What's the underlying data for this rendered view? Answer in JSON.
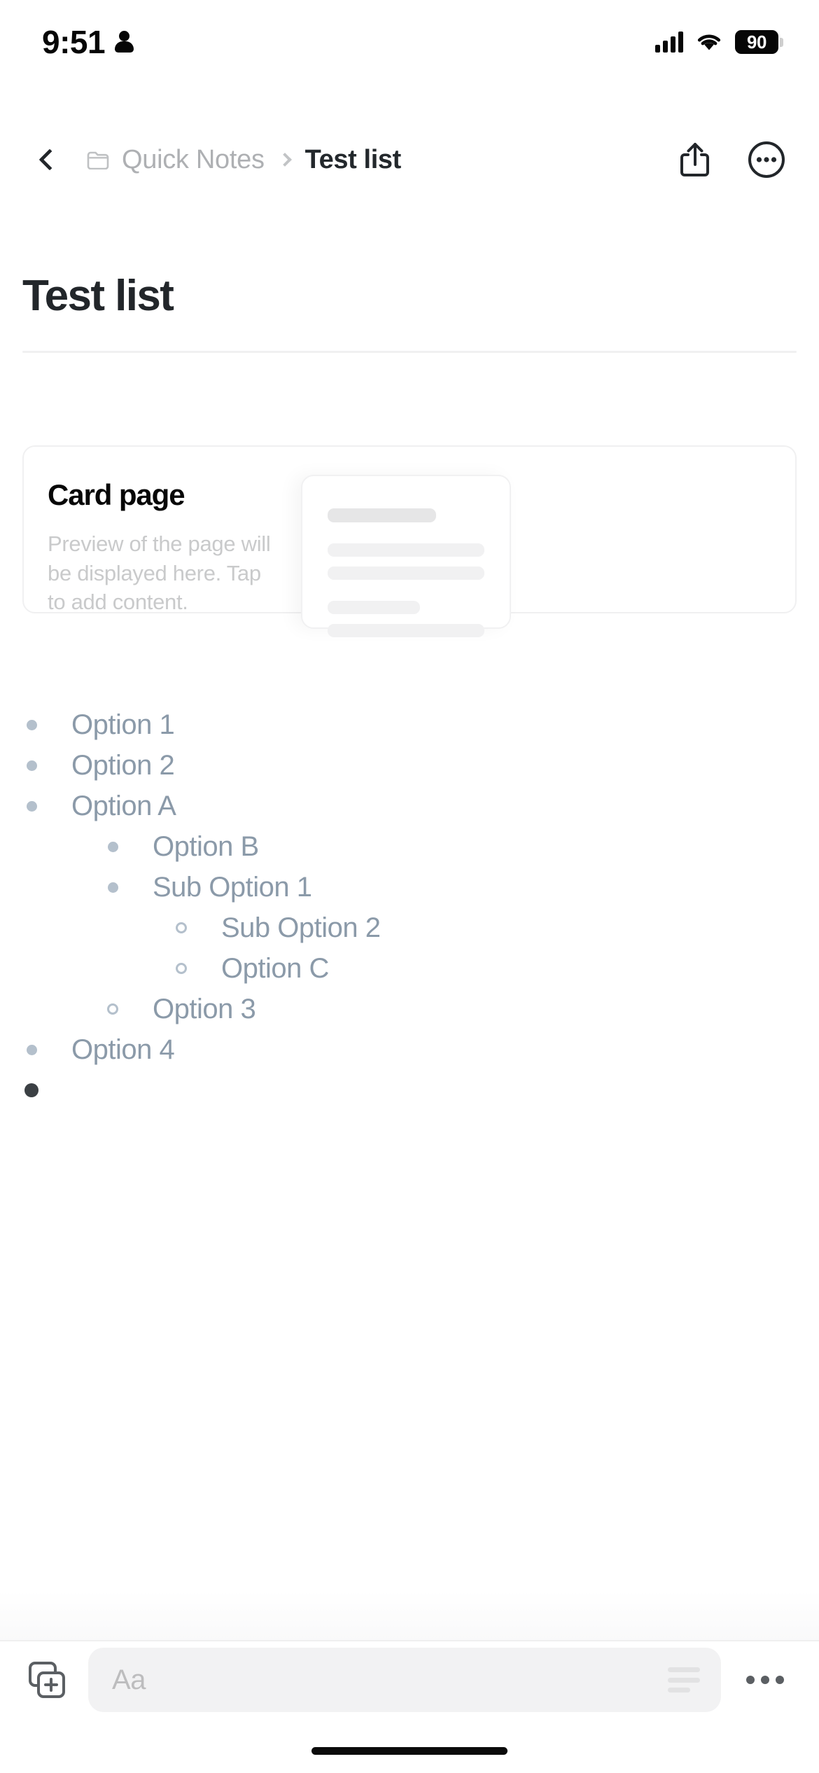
{
  "status_bar": {
    "time": "9:51",
    "person_icon": "person-icon",
    "signal_icon": "cellular-signal-icon",
    "wifi_icon": "wifi-icon",
    "battery_level": "90"
  },
  "nav": {
    "back_icon": "chevron-left-icon",
    "folder_icon": "folder-icon",
    "parent_label": "Quick Notes",
    "separator": "›",
    "current_label": "Test list",
    "share_icon": "share-icon",
    "more_icon": "more-circle-icon"
  },
  "document": {
    "title": "Test list"
  },
  "card": {
    "title": "Card page",
    "subtitle": "Preview of the page will be displayed here. Tap to add content.",
    "thumbnail_icon": "page-preview-skeleton"
  },
  "list": {
    "items": [
      {
        "label": "Option 1",
        "level": 0,
        "marker": "filled"
      },
      {
        "label": "Option 2",
        "level": 0,
        "marker": "filled"
      },
      {
        "label": "Option A",
        "level": 0,
        "marker": "filled"
      },
      {
        "label": "Option B",
        "level": 1,
        "marker": "filled"
      },
      {
        "label": "Sub Option 1",
        "level": 1,
        "marker": "filled"
      },
      {
        "label": "Sub Option 2",
        "level": 2,
        "marker": "hollow"
      },
      {
        "label": "Option C",
        "level": 2,
        "marker": "hollow"
      },
      {
        "label": "Option 3",
        "level": 1,
        "marker": "hollow"
      },
      {
        "label": "Option 4",
        "level": 0,
        "marker": "filled"
      },
      {
        "label": "",
        "level": 0,
        "marker": "dark"
      }
    ]
  },
  "toolbar": {
    "add_page_icon": "add-page-icon",
    "input_placeholder": "Aa",
    "format_lines_icon": "text-lines-icon",
    "more_icon": "more-horizontal-icon"
  },
  "colors": {
    "text_primary": "#22262a",
    "text_muted": "#aeb0b3",
    "list_text": "#8b9aa9",
    "bullet": "#b4c0cc",
    "bullet_active": "#3b4044",
    "divider": "#f0f0f1",
    "input_bg": "#f2f2f3"
  }
}
